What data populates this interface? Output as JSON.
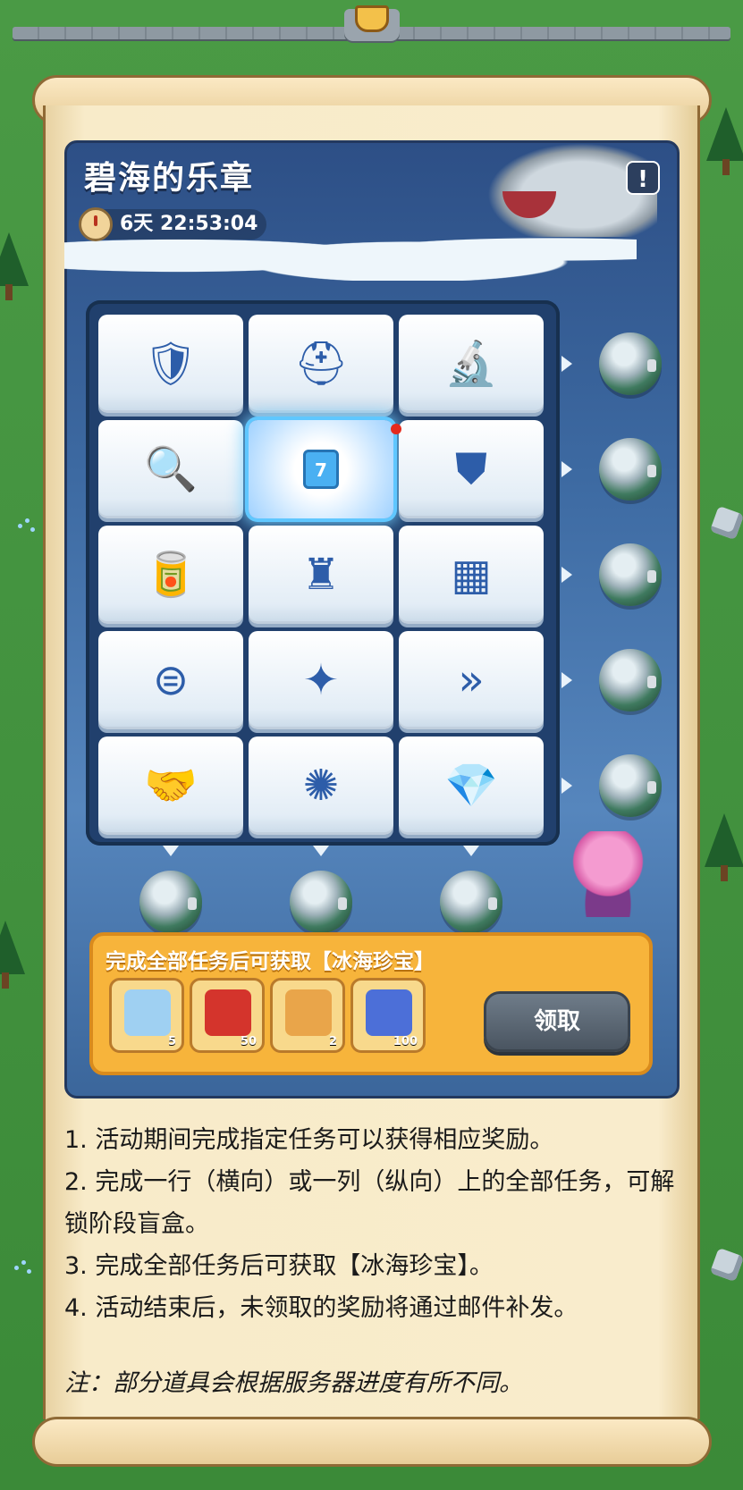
{
  "event": {
    "title": "碧海的乐章",
    "timer": "6天 22:53:04",
    "info_icon": "info-icon"
  },
  "board": {
    "rows": [
      [
        {
          "icon": "wrench-shield-icon",
          "glyph": "🛡"
        },
        {
          "icon": "helmet-icon",
          "glyph": "⛑"
        },
        {
          "icon": "microscope-icon",
          "glyph": "🔬"
        }
      ],
      [
        {
          "icon": "magnifier-icon",
          "glyph": "🔍"
        },
        {
          "icon": "calendar-icon",
          "glyph": "7"
        },
        {
          "icon": "badge-banner-icon",
          "glyph": "⛊"
        }
      ],
      [
        {
          "icon": "canned-food-icon",
          "glyph": "🥫"
        },
        {
          "icon": "castle-upgrade-icon",
          "glyph": "♜"
        },
        {
          "icon": "treasure-chest-icon",
          "glyph": "▦"
        }
      ],
      [
        {
          "icon": "barrel-icon",
          "glyph": "⊜"
        },
        {
          "icon": "wolf-head-icon",
          "glyph": "✦"
        },
        {
          "icon": "speed-up-icon",
          "glyph": "»"
        }
      ],
      [
        {
          "icon": "handshake-icon",
          "glyph": "🤝"
        },
        {
          "icon": "beast-head-icon",
          "glyph": "✺"
        },
        {
          "icon": "diamond-icon",
          "glyph": "💎"
        }
      ]
    ],
    "active_tile": "calendar-icon",
    "row_reward_icon": "blind-box-icon",
    "col_reward_icon": "blind-box-icon",
    "final_reward_icon": "octopus-treasure-icon"
  },
  "rewards": {
    "title": "完成全部任务后可获取【冰海珍宝】",
    "items": [
      {
        "icon": "ice-map-icon",
        "qty": "5",
        "color": "#9fd0f2"
      },
      {
        "icon": "red-crystal-icon",
        "qty": "50",
        "color": "#d4342c"
      },
      {
        "icon": "puzzle-piece-icon",
        "qty": "2",
        "color": "#e9a54a"
      },
      {
        "icon": "blue-medal-icon",
        "qty": "100",
        "color": "#4c6fd8"
      }
    ],
    "claim_label": "领取"
  },
  "rules": [
    "1. 活动期间完成指定任务可以获得相应奖励。",
    "2. 完成一行（横向）或一列（纵向）上的全部任务，可解锁阶段盲盒。",
    "3. 完成全部任务后可获取【冰海珍宝】。",
    "4. 活动结束后，未领取的奖励将通过邮件补发。"
  ],
  "note": "注：部分道具会根据服务器进度有所不同。"
}
